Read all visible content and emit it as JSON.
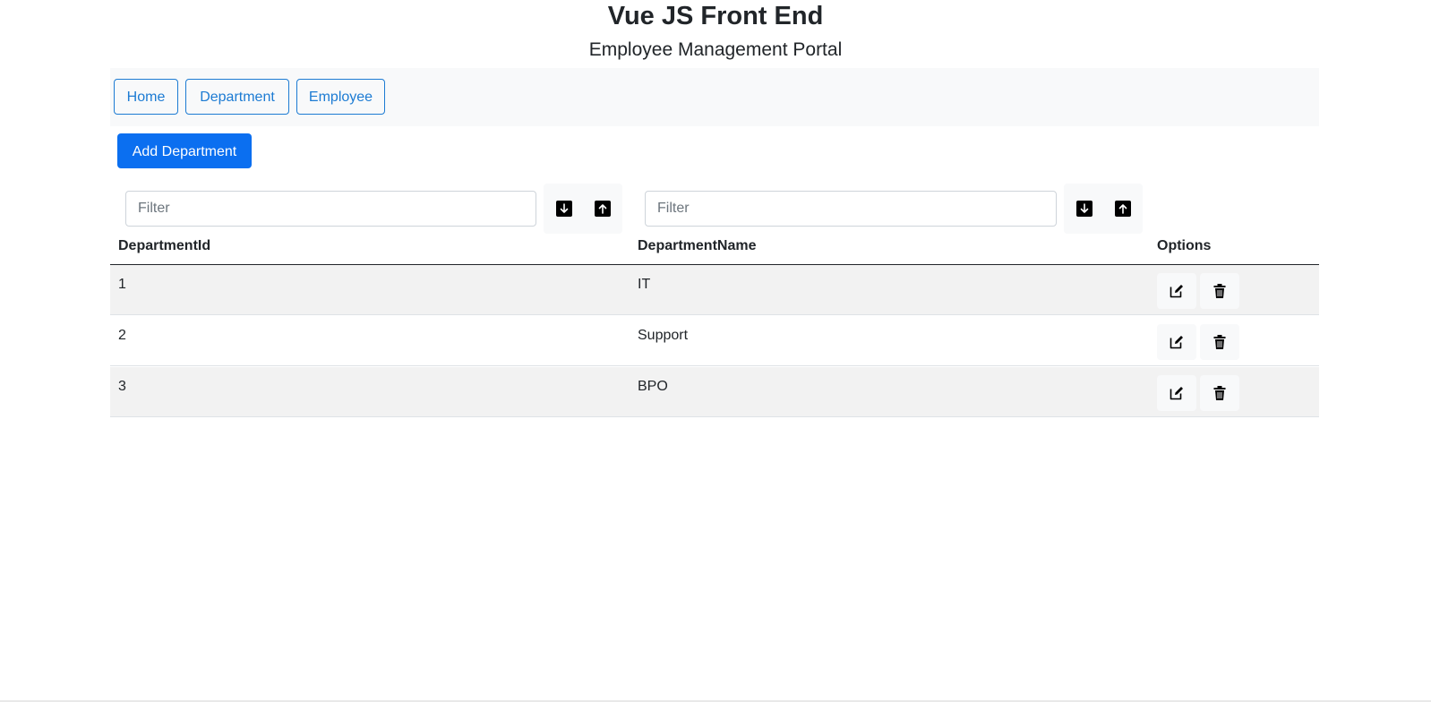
{
  "header": {
    "title": "Vue JS Front End",
    "subtitle": "Employee Management Portal"
  },
  "nav": {
    "items": [
      {
        "label": "Home"
      },
      {
        "label": "Department"
      },
      {
        "label": "Employee"
      }
    ]
  },
  "actions": {
    "add_label": "Add Department"
  },
  "filters": {
    "id_placeholder": "Filter",
    "name_placeholder": "Filter"
  },
  "table": {
    "columns": [
      "DepartmentId",
      "DepartmentName",
      "Options"
    ],
    "rows": [
      {
        "id": "1",
        "name": "IT"
      },
      {
        "id": "2",
        "name": "Support"
      },
      {
        "id": "3",
        "name": "BPO"
      }
    ]
  },
  "icons": {
    "sort_desc": "arrow-down-icon",
    "sort_asc": "arrow-up-icon",
    "edit": "edit-icon",
    "delete": "trash-icon"
  },
  "colors": {
    "primary": "#0b6ff0",
    "nav_outline": "#1c7bd3",
    "navbar_bg": "#f8f9fa",
    "stripe": "#f2f2f2"
  }
}
